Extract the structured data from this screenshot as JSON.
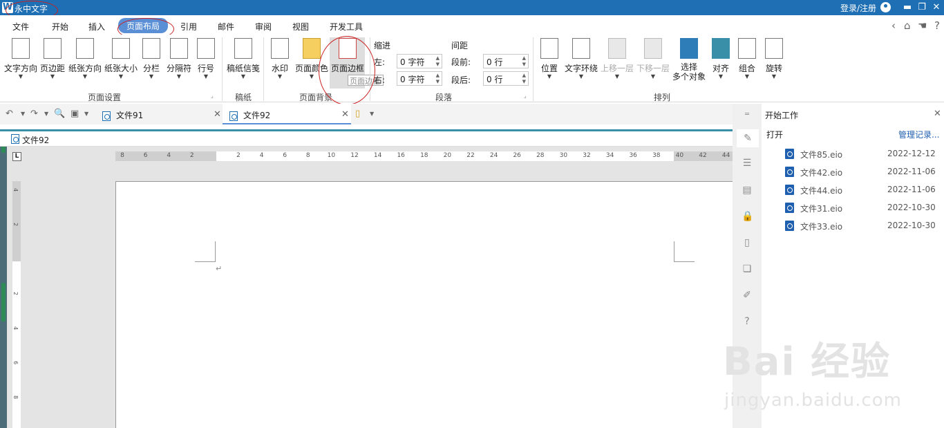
{
  "app": {
    "title": "永中文字",
    "login": "登录/注册"
  },
  "menu": [
    "文件",
    "开始",
    "插入",
    "页面布局",
    "引用",
    "邮件",
    "审阅",
    "视图",
    "开发工具"
  ],
  "ribbon": {
    "page_setup": {
      "group": "页面设置",
      "buttons": [
        "文字方向",
        "页边距",
        "纸张方向",
        "纸张大小",
        "分栏",
        "分隔符",
        "行号"
      ]
    },
    "manuscript": {
      "group": "稿纸",
      "buttons": [
        "稿纸信笺"
      ]
    },
    "background": {
      "group": "页面背景",
      "buttons": [
        "水印",
        "页面颜色",
        "页面边框"
      ],
      "tooltip": "页面边框"
    },
    "paragraph": {
      "group": "段落",
      "indent_label": "缩进",
      "spacing_label": "间距",
      "left_label": "左:",
      "right_label": "右:",
      "before_label": "段前:",
      "after_label": "段后:",
      "left_value": "0 字符",
      "right_value": "0 字符",
      "before_value": "0 行",
      "after_value": "0 行"
    },
    "arrange": {
      "group": "排列",
      "buttons": [
        "位置",
        "文字环绕",
        "上移一层",
        "下移一层",
        "选择\n多个对象",
        "对齐",
        "组合",
        "旋转"
      ]
    }
  },
  "tabs": {
    "tab1": "文件91",
    "tab2": "文件92"
  },
  "path": "文件92",
  "ruler": {
    "top": [
      "8",
      "6",
      "4",
      "2",
      "",
      "2",
      "4",
      "6",
      "8",
      "10",
      "12",
      "14",
      "16",
      "18",
      "20",
      "22",
      "24",
      "26",
      "28",
      "30",
      "32",
      "34",
      "36",
      "38",
      "40",
      "42",
      "44"
    ],
    "left": [
      "4",
      "2",
      "",
      "2",
      "4",
      "6",
      "8"
    ]
  },
  "panel": {
    "title": "开始工作",
    "open": "打开",
    "manage": "管理记录...",
    "files": [
      {
        "name": "文件85.eio",
        "date": "2022-12-12"
      },
      {
        "name": "文件42.eio",
        "date": "2022-11-06"
      },
      {
        "name": "文件44.eio",
        "date": "2022-11-06"
      },
      {
        "name": "文件31.eio",
        "date": "2022-10-30"
      },
      {
        "name": "文件33.eio",
        "date": "2022-10-30"
      }
    ]
  },
  "watermark": {
    "main": "Bai 经验",
    "sub": "jingyan.baidu.com"
  },
  "colors": {
    "titlebar": "#1f6fb4",
    "active_tab": "#5a8fd6",
    "annotation": "#cc2222"
  }
}
